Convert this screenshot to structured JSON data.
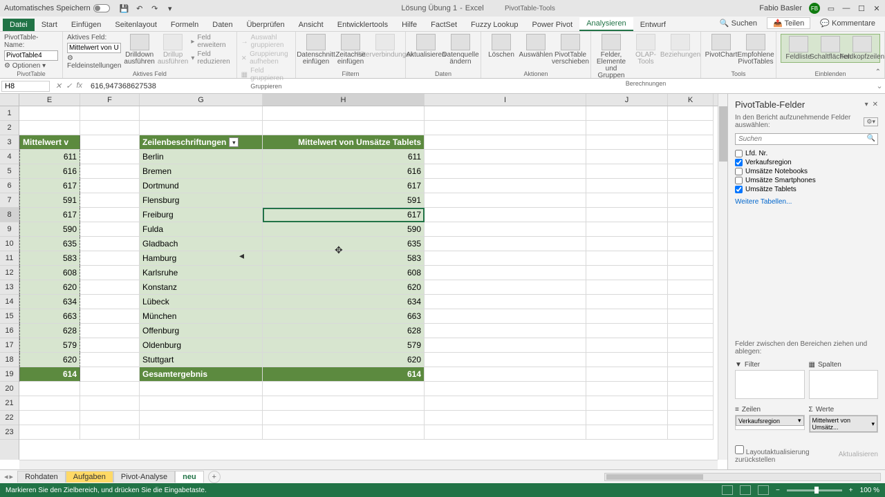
{
  "titlebar": {
    "autosave_label": "Automatisches Speichern",
    "doc_title": "Lösung Übung 1",
    "app_name": "Excel",
    "contextual_title": "PivotTable-Tools",
    "user_name": "Fabio Basler",
    "user_initials": "FB"
  },
  "ribbon_tabs": {
    "file": "Datei",
    "tabs": [
      "Start",
      "Einfügen",
      "Seitenlayout",
      "Formeln",
      "Daten",
      "Überprüfen",
      "Ansicht",
      "Entwicklertools",
      "Hilfe",
      "FactSet",
      "Fuzzy Lookup",
      "Power Pivot",
      "Analysieren",
      "Entwurf"
    ],
    "search": "Suchen",
    "share": "Teilen",
    "comments": "Kommentare"
  },
  "ribbon": {
    "pivot_name_label": "PivotTable-Name:",
    "pivot_name_value": "PivotTable4",
    "options_label": "Optionen",
    "group_pivot": "PivotTable",
    "active_field_label": "Aktives Feld:",
    "active_field_value": "Mittelwert von Ur",
    "field_settings": "Feldeinstellungen",
    "drilldown": "Drilldown ausführen",
    "drillup": "Drillup ausführen",
    "expand_field": "Feld erweitern",
    "collapse_field": "Feld reduzieren",
    "group_active": "Aktives Feld",
    "group_selection": "Auswahl gruppieren",
    "ungroup": "Gruppierung aufheben",
    "group_field": "Feld gruppieren",
    "group_group": "Gruppieren",
    "insert_slicer": "Datenschnitt einfügen",
    "insert_timeline": "Zeitachse einfügen",
    "filter_conn": "Filterverbindungen",
    "group_filter": "Filtern",
    "refresh": "Aktualisieren",
    "change_source": "Datenquelle ändern",
    "group_data": "Daten",
    "clear": "Löschen",
    "select": "Auswählen",
    "move": "PivotTable verschieben",
    "group_actions": "Aktionen",
    "fields_items": "Felder, Elemente und Gruppen",
    "olap": "OLAP-Tools",
    "relations": "Beziehungen",
    "group_calc": "Berechnungen",
    "pivotchart": "PivotChart",
    "recommended": "Empfohlene PivotTables",
    "group_tools": "Tools",
    "fieldlist": "Feldliste",
    "buttons_pm": "Schaltflächen",
    "headers": "Feldkopfzeilen",
    "group_show": "Einblenden"
  },
  "formula_bar": {
    "name_box": "H8",
    "formula": "616,947368627538"
  },
  "columns": [
    "E",
    "F",
    "G",
    "H",
    "I",
    "J",
    "K"
  ],
  "row_numbers": [
    1,
    2,
    3,
    4,
    5,
    6,
    7,
    8,
    9,
    10,
    11,
    12,
    13,
    14,
    15,
    16,
    17,
    18,
    19,
    20,
    21,
    22,
    23
  ],
  "pivot": {
    "header_e": "Mittelwert v",
    "header_g": "Zeilenbeschriftungen",
    "header_h": "Mittelwert von Umsätze Tablets",
    "rows": [
      {
        "label": "Berlin",
        "e": "611",
        "h": "611"
      },
      {
        "label": "Bremen",
        "e": "616",
        "h": "616"
      },
      {
        "label": "Dortmund",
        "e": "617",
        "h": "617"
      },
      {
        "label": "Flensburg",
        "e": "591",
        "h": "591"
      },
      {
        "label": "Freiburg",
        "e": "617",
        "h": "617"
      },
      {
        "label": "Fulda",
        "e": "590",
        "h": "590"
      },
      {
        "label": "Gladbach",
        "e": "635",
        "h": "635"
      },
      {
        "label": "Hamburg",
        "e": "583",
        "h": "583"
      },
      {
        "label": "Karlsruhe",
        "e": "608",
        "h": "608"
      },
      {
        "label": "Konstanz",
        "e": "620",
        "h": "620"
      },
      {
        "label": "Lübeck",
        "e": "634",
        "h": "634"
      },
      {
        "label": "München",
        "e": "663",
        "h": "663"
      },
      {
        "label": "Offenburg",
        "e": "628",
        "h": "628"
      },
      {
        "label": "Oldenburg",
        "e": "579",
        "h": "579"
      },
      {
        "label": "Stuttgart",
        "e": "620",
        "h": "620"
      }
    ],
    "total_label": "Gesamtergebnis",
    "total_e": "614",
    "total_h": "614"
  },
  "fieldlist": {
    "title": "PivotTable-Felder",
    "subtitle": "In den Bericht aufzunehmende Felder auswählen:",
    "search_placeholder": "Suchen",
    "fields": [
      {
        "name": "Lfd. Nr.",
        "checked": false
      },
      {
        "name": "Verkaufsregion",
        "checked": true
      },
      {
        "name": "Umsätze Notebooks",
        "checked": false
      },
      {
        "name": "Umsätze Smartphones",
        "checked": false
      },
      {
        "name": "Umsätze Tablets",
        "checked": true
      }
    ],
    "more_tables": "Weitere Tabellen...",
    "drag_label": "Felder zwischen den Bereichen ziehen und ablegen:",
    "filter_label": "Filter",
    "columns_label": "Spalten",
    "rows_label": "Zeilen",
    "values_label": "Werte",
    "row_pill": "Verkaufsregion",
    "value_pill": "Mittelwert von Umsätz...",
    "defer_label": "Layoutaktualisierung zurückstellen",
    "update_btn": "Aktualisieren"
  },
  "sheet_tabs": [
    "Rohdaten",
    "Aufgaben",
    "Pivot-Analyse",
    "neu"
  ],
  "active_sheet": 1,
  "statusbar": {
    "msg": "Markieren Sie den Zielbereich, und drücken Sie die Eingabetaste.",
    "zoom": "100 %"
  }
}
